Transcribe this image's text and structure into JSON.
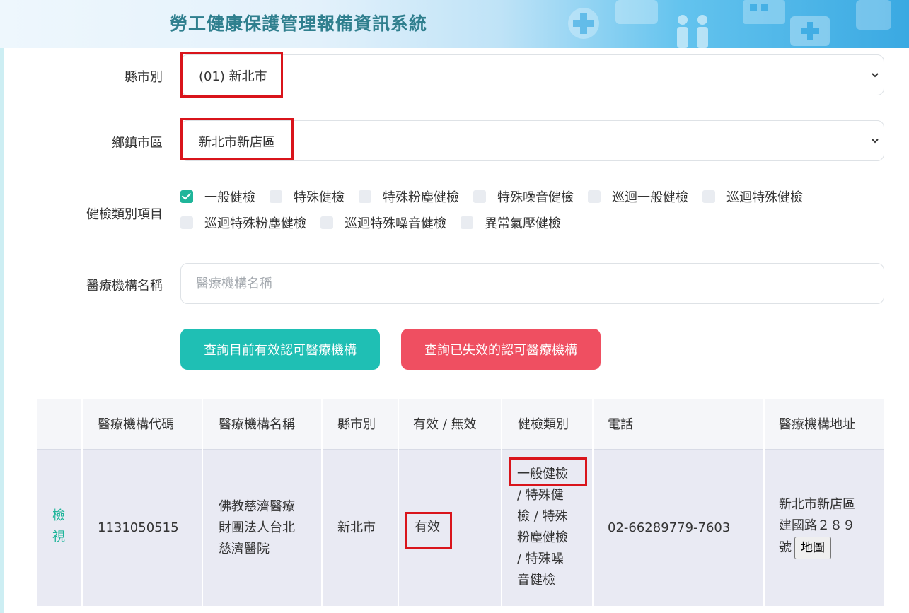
{
  "header": {
    "title": "勞工健康保護管理報備資訊系統"
  },
  "form": {
    "city": {
      "label": "縣市別",
      "value": "(01) 新北市"
    },
    "district": {
      "label": "鄉鎮市區",
      "value": "新北市新店區"
    },
    "categories": {
      "label": "健檢類別項目",
      "items": [
        {
          "label": "一般健檢",
          "checked": true
        },
        {
          "label": "特殊健檢",
          "checked": false
        },
        {
          "label": "特殊粉塵健檢",
          "checked": false
        },
        {
          "label": "特殊噪音健檢",
          "checked": false
        },
        {
          "label": "巡迴一般健檢",
          "checked": false
        },
        {
          "label": "巡迴特殊健檢",
          "checked": false
        },
        {
          "label": "巡迴特殊粉塵健檢",
          "checked": false
        },
        {
          "label": "巡迴特殊噪音健檢",
          "checked": false
        },
        {
          "label": "異常氣壓健檢",
          "checked": false
        }
      ]
    },
    "institution_name": {
      "label": "醫療機構名稱",
      "placeholder": "醫療機構名稱"
    },
    "buttons": {
      "query_valid": "查詢目前有效認可醫療機構",
      "query_invalid": "查詢已失效的認可醫療機構"
    }
  },
  "table": {
    "headers": [
      "醫療機構代碼",
      "醫療機構名稱",
      "縣市別",
      "有效 / 無效",
      "健檢類別",
      "電話",
      "醫療機構地址"
    ],
    "rows": [
      {
        "view_line1": "檢",
        "view_line2": "視",
        "code": "1131050515",
        "name_line1": "佛教慈濟醫療",
        "name_line2": "財團法人台北",
        "name_line3": "慈濟醫院",
        "city": "新北市",
        "status": "有效",
        "cat_line1": "一般健檢",
        "cat_line2": "/ 特殊健",
        "cat_line3": "檢 / 特殊",
        "cat_line4": "粉塵健檢",
        "cat_line5": "/ 特殊噪",
        "cat_line6": "音健檢",
        "phone": "02-66289779-7603",
        "addr_line1": "新北市新店區",
        "addr_line2": "建國路２８９",
        "addr_line3": "號",
        "map_label": "地圖"
      }
    ]
  },
  "colors": {
    "accent_teal": "#1fbfb4",
    "danger_red": "#ef4f61",
    "highlight": "#d9141b",
    "title": "#2f7f8e"
  }
}
